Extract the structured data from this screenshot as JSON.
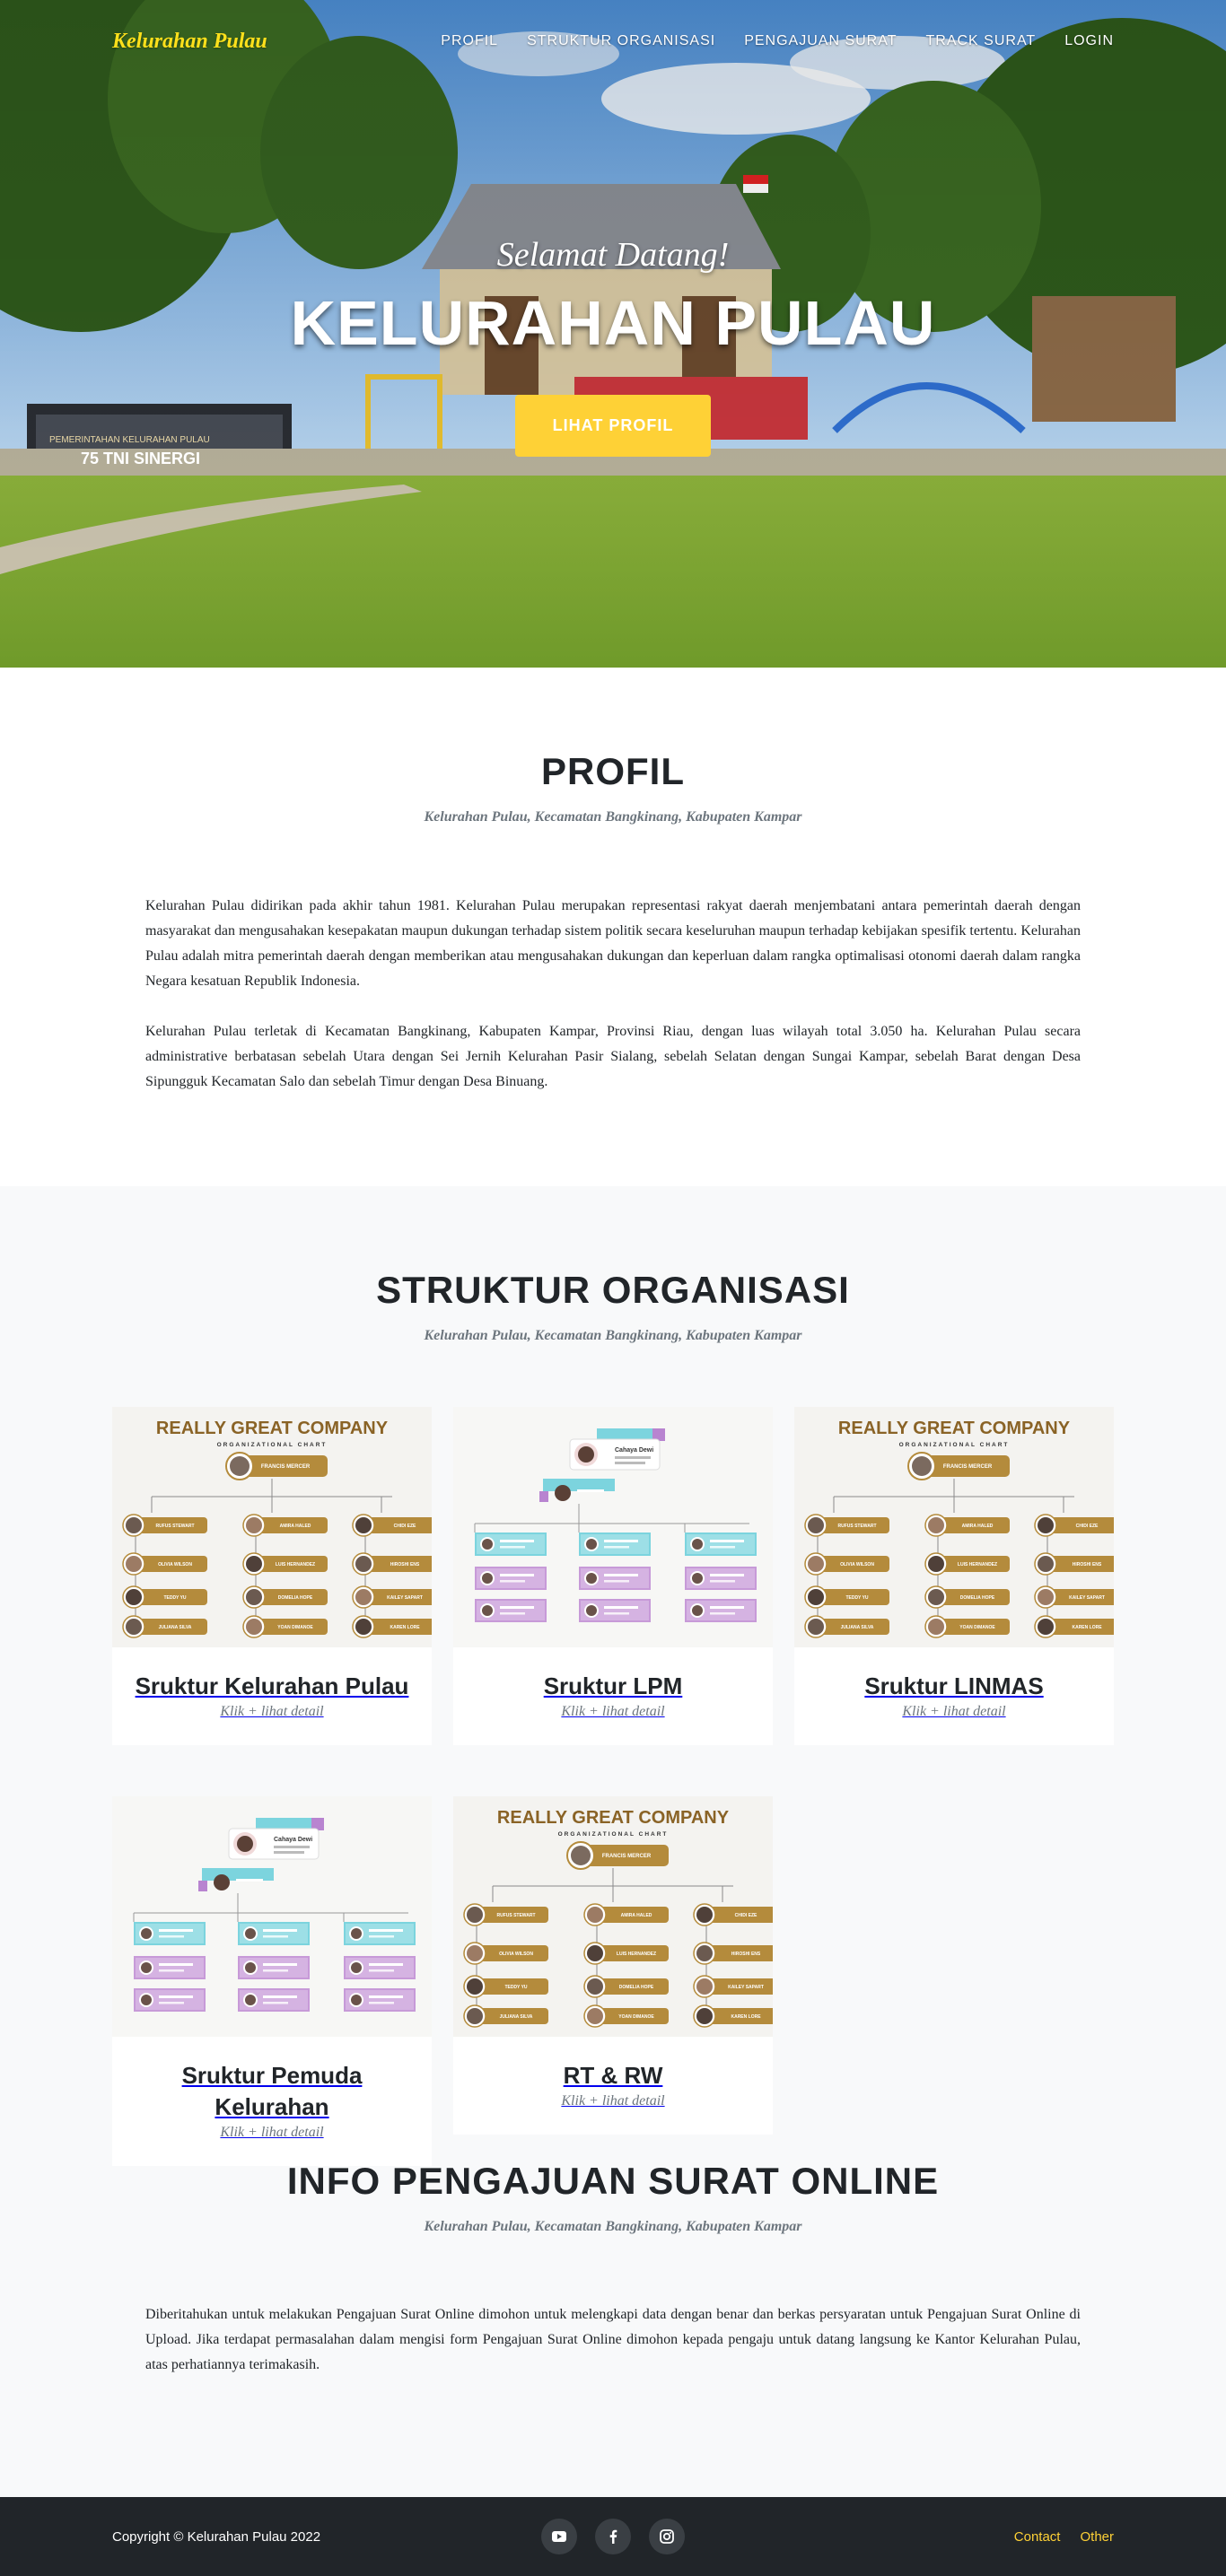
{
  "nav": {
    "brand": "Kelurahan Pulau",
    "links": [
      "PROFIL",
      "STRUKTUR ORGANISASI",
      "PENGAJUAN SURAT",
      "TRACK SURAT",
      "LOGIN"
    ]
  },
  "hero": {
    "subtitle": "Selamat Datang!",
    "title": "KELURAHAN PULAU",
    "button": "LIHAT PROFIL",
    "banner_text_1": "PEMERINTAHAN KELURAHAN PULAU",
    "banner_text_2": "75 TNI SINERGI"
  },
  "profil": {
    "heading": "PROFIL",
    "subheading": "Kelurahan Pulau, Kecamatan Bangkinang, Kabupaten Kampar",
    "paragraphs": [
      "Kelurahan Pulau didirikan pada akhir tahun 1981. Kelurahan Pulau merupakan representasi rakyat daerah menjembatani antara pemerintah daerah dengan masyarakat dan mengusahakan kesepakatan maupun dukungan terhadap sistem politik secara keseluruhan maupun terhadap kebijakan spesifik tertentu. Kelurahan Pulau adalah mitra pemerintah daerah dengan memberikan atau mengusahakan dukungan dan keperluan dalam rangka optimalisasi otonomi daerah dalam rangka Negara kesatuan Republik Indonesia.",
      "Kelurahan Pulau terletak di Kecamatan Bangkinang, Kabupaten Kampar, Provinsi Riau, dengan luas wilayah total 3.050 ha. Kelurahan Pulau secara administrative berbatasan sebelah Utara dengan Sei Jernih Kelurahan Pasir Sialang, sebelah Selatan dengan Sungai Kampar, sebelah Barat dengan Desa Sipungguk Kecamatan Salo dan sebelah Timur dengan Desa Binuang."
    ]
  },
  "struktur": {
    "heading": "STRUKTUR ORGANISASI",
    "subheading": "Kelurahan Pulau, Kecamatan Bangkinang, Kabupaten Kampar",
    "chart_img": {
      "company": "REALLY GREAT COMPANY",
      "subtitle": "ORGANIZATIONAL CHART",
      "head_name": "FRANCIS MERCER",
      "tier1": [
        "RUFUS STEWART",
        "AMIRA HALED",
        "CHIDI EZE"
      ],
      "tier2": [
        "OLIVIA WILSON",
        "LUIS HERNANDEZ",
        "HIROSHI ENS"
      ],
      "tier3": [
        "TEDDY YU",
        "DOMELIA HOPE",
        "KAILEY SAPART"
      ],
      "tier4": [
        "JULIANA SILVA",
        "YOAN DIMANOE",
        "KAREN LORE"
      ],
      "alt_head": "Cahaya Dewi"
    },
    "cards": [
      {
        "title": "Sruktur Kelurahan Pulau",
        "sub": "Klik + lihat detail"
      },
      {
        "title": "Sruktur LPM",
        "sub": "Klik + lihat detail"
      },
      {
        "title": "Sruktur LINMAS",
        "sub": "Klik + lihat detail"
      },
      {
        "title": "Sruktur Pemuda Kelurahan",
        "sub": "Klik + lihat detail"
      },
      {
        "title": "RT & RW",
        "sub": "Klik + lihat detail"
      }
    ]
  },
  "info": {
    "heading": "INFO PENGAJUAN SURAT ONLINE",
    "subheading": "Kelurahan Pulau, Kecamatan Bangkinang, Kabupaten Kampar",
    "paragraph": "Diberitahukan untuk melakukan Pengajuan Surat Online dimohon untuk melengkapi data dengan benar dan berkas persyaratan untuk Pengajuan Surat Online di Upload. Jika terdapat permasalahan dalam mengisi form Pengajuan Surat Online dimohon kepada pengaju untuk datang langsung ke Kantor Kelurahan Pulau, atas perhatiannya terimakasih."
  },
  "footer": {
    "copyright": "Copyright © Kelurahan Pulau 2022",
    "socials": [
      "youtube-icon",
      "facebook-icon",
      "instagram-icon"
    ],
    "links": [
      "Contact",
      "Other"
    ]
  },
  "colors": {
    "accent": "#fed136",
    "brand_yellow": "#ffe01b",
    "dark": "#212529",
    "light_bg": "#f8f9fa",
    "chart_gold": "#b48b3c"
  }
}
